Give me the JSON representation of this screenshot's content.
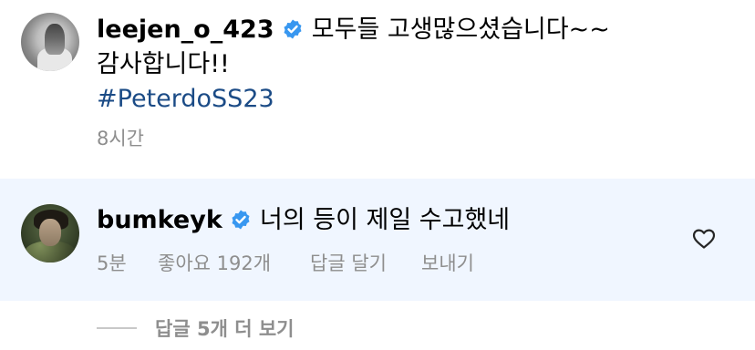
{
  "caption": {
    "username": "leejen_o_423",
    "text_line1": "모두들 고생많으셨습니다~~",
    "text_line2": "감사합니다!!",
    "hashtag": "#PeterdoSS23",
    "time": "8시간"
  },
  "reply": {
    "username": "bumkeyk",
    "text": "너의 등이 제일 수고했네",
    "time": "5분",
    "likes": "좋아요 192개",
    "reply_label": "답글 달기",
    "send_label": "보내기"
  },
  "view_more": "답글 5개 더 보기",
  "colors": {
    "verified": "#3897f0",
    "hashtag": "#1b4b86",
    "meta_gray": "#8e8e8e",
    "reply_highlight": "#f0f6ff"
  },
  "icons": [
    "verified-badge-icon",
    "heart-icon"
  ]
}
